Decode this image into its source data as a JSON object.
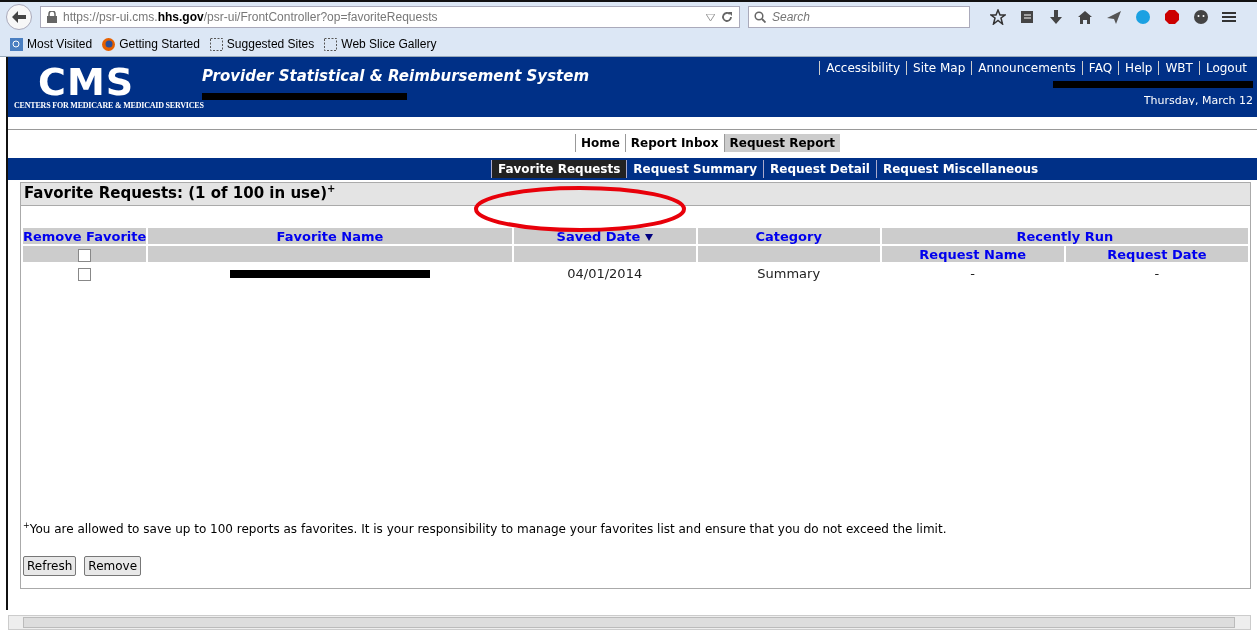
{
  "browser": {
    "url": "https://psr-ui.cms.**hhs.gov**/psr-ui/FrontController?op=favoriteRequests",
    "search": {
      "placeholder": "Search"
    },
    "bookmarks": [
      {
        "label": "Most Visited",
        "kind": "search"
      },
      {
        "label": "Getting Started",
        "kind": "firefox"
      },
      {
        "label": "Suggested Sites",
        "kind": "dashed"
      },
      {
        "label": "Web Slice Gallery",
        "kind": "dashed"
      }
    ]
  },
  "header": {
    "logo": "CMS",
    "logo_subtitle": "CENTERS FOR MEDICARE & MEDICAID SERVICES",
    "title": "Provider Statistical & Reimbursement System",
    "links": [
      "Accessibility",
      "Site Map",
      "Announcements",
      "FAQ",
      "Help",
      "WBT",
      "Logout"
    ],
    "date": "Thursday, March 12"
  },
  "tabs": [
    {
      "label": "Home",
      "selected": false
    },
    {
      "label": "Report Inbox",
      "selected": false
    },
    {
      "label": "Request Report",
      "selected": true
    }
  ],
  "subtabs": [
    {
      "label": "Favorite Requests",
      "selected": true
    },
    {
      "label": "Request Summary",
      "selected": false
    },
    {
      "label": "Request Detail",
      "selected": false
    },
    {
      "label": "Request Miscellaneous",
      "selected": false
    }
  ],
  "panel": {
    "title": "Favorite Requests: (1 of 100 in use)$^{+}$",
    "table": {
      "columns": [
        {
          "label": "Remove Favorite",
          "sorted": false
        },
        {
          "label": "Favorite Name",
          "sorted": false
        },
        {
          "label": "Saved Date",
          "sorted": true
        },
        {
          "label": "Category",
          "sorted": false
        },
        {
          "label": "Recently Run",
          "sorted": false
        }
      ],
      "subcolumns": [
        "Request Name",
        "Request Date"
      ],
      "select_all": {
        "checked": false
      },
      "rows": [
        {
          "checked": false,
          "saved_date": "04/01/2014",
          "category": "Summary",
          "request_name": "-",
          "request_date": "-"
        }
      ]
    },
    "footnote": "$^{+}$You are allowed to save up to 100 reports as favorites. It is your responsibility to manage your favorites list and ensure that you do not exceed the limit.",
    "buttons": [
      "Refresh",
      "Remove"
    ]
  }
}
